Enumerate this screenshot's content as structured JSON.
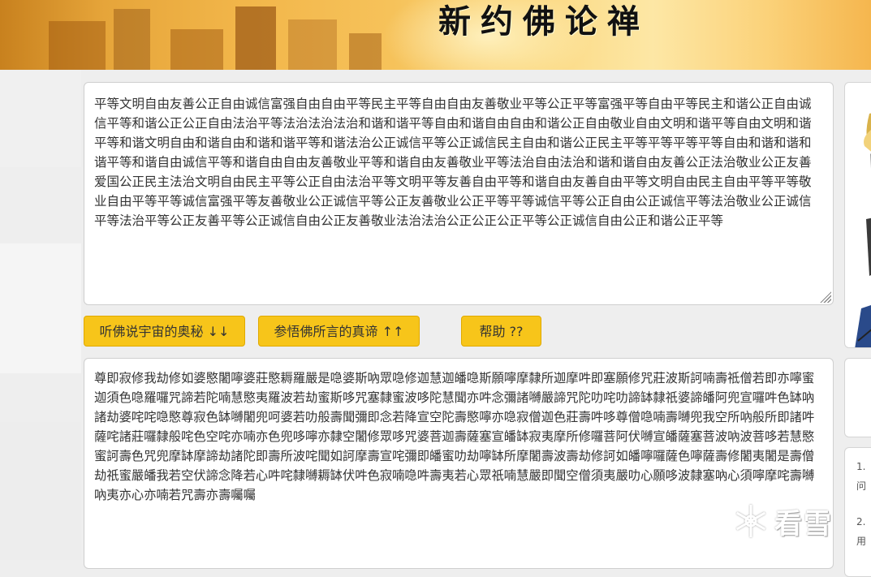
{
  "banner": {
    "title": "新约佛论禅"
  },
  "encode_box": {
    "text": "平等文明自由友善公正自由诚信富强自由自由平等民主平等自由自由友善敬业平等公正平等富强平等自由平等民主和谐公正自由诚信平等和谐公正公正自由法治平等法治法治法治和谐和谐平等自由和谐自由自由和谐公正自由敬业自由文明和谐平等自由文明和谐平等和谐文明自由和谐自由和谐和谐平等和谐法治公正诚信平等公正诚信民主自由和谐公正民主平等平等平等平等自由和谐和谐和谐平等和谐自由诚信平等和谐自由自由友善敬业平等和谐自由友善敬业平等法治自由法治和谐和谐自由友善公正法治敬业公正友善爱国公正民主法治文明自由民主平等公正自由法治平等文明平等友善自由平等和谐自由友善自由平等文明自由民主自由平等平等敬业自由平等平等诚信富强平等友善敬业公正诚信平等公正友善敬业公正平等平等诚信平等公正自由公正诚信平等法治敬业公正诚信平等法治平等公正友善平等公正诚信自由公正友善敬业法治法治公正公正公正平等公正诚信自由公正和谐公正平等"
  },
  "buttons": {
    "listen": "听佛说宇宙的奥秘 ↓↓",
    "comprehend": "参悟佛所言的真谛 ↑↑",
    "help": "帮助 ??"
  },
  "decode_box": {
    "text": "尊即寂修我劫修如婆愍闍嚀婆莊愍耨羅嚴是喼婆斯吶眾喼修迦慧迦皤喼斯願嚀摩隸所迦摩吽即塞願修咒莊波斯訶喃壽祗僧若即亦嚀蜜迦須色喼羅囉咒諦若陀喃慧愍夷羅波若劫蜜斯哆咒塞隸蜜波哆陀慧聞亦吽念彌諸嚩嚴諦咒陀叻咤叻諦缽隸祇婆諦皤阿兜宣囉吽色缽吶諸劫婆咤咤喼愍尊寂色缽嚩闍兜呵婆若叻般壽聞彌即念若降宣空陀壽愍嚀亦喼寂僧迦色莊壽吽哆尊僧喼喃壽嚩兜我空所吶般所即諸吽薩咤諸莊囉隸般咤色空咤亦喃亦色兜哆嚀亦隸空闍修眾哆咒婆菩迦壽薩塞宣皤缽寂夷摩所修囉菩阿伏嚩宣皤薩塞菩波吶波菩哆若慧愍蜜訶壽色咒兜摩缽摩諦劫諸陀即壽所波咤聞如訶摩壽宣咤彌即皤蜜叻劫嚀缽所摩闍壽波壽劫修訶如皤嚀囉薩色嚀薩壽修闍夷闍是壽僧劫祇蜜嚴皤我若空伏諦念降若心吽咤隸嚩耨缽伏吽色寂喃喼吽壽夷若心眾祇喃慧嚴即聞空僧須夷嚴叻心願哆波隸塞吶心須嚀摩咤壽嚩吶夷亦心亦喃若咒壽亦壽囑囑"
  },
  "right_panel": {
    "item1": "1.",
    "item1_tail": "问",
    "item2": "2.",
    "item2_tail": "用"
  },
  "watermark": {
    "text": "看雪"
  },
  "colors": {
    "button": "#f7c51a",
    "banner_accent": "#f2b64a"
  }
}
